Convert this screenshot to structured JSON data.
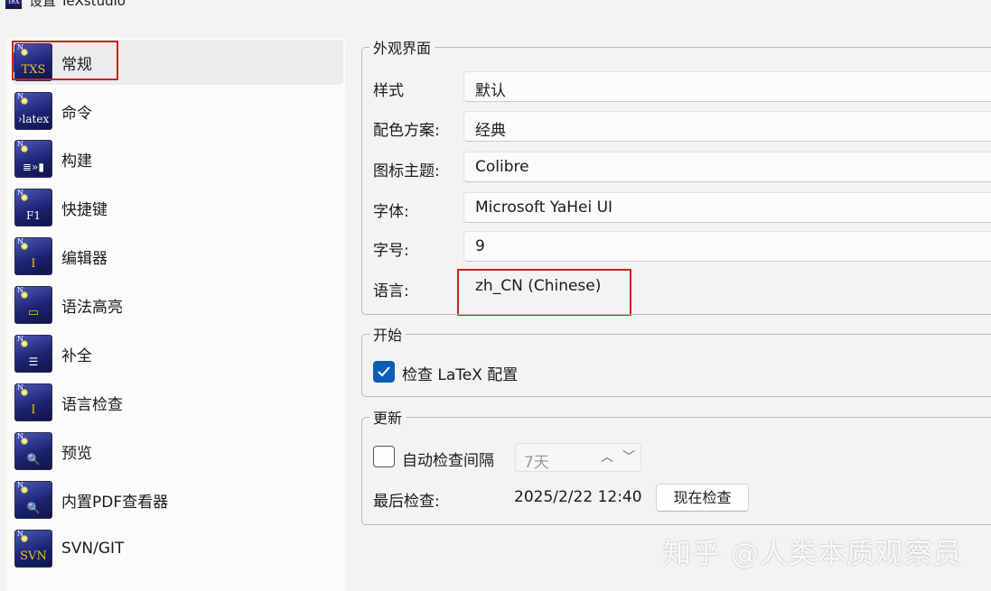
{
  "window": {
    "title": "设置 TeXstudio",
    "icon": "texstudio-app-icon"
  },
  "sidebar": {
    "items": [
      {
        "label": "常规",
        "icon": "txs-icon",
        "glyph": "TXS",
        "selected": true
      },
      {
        "label": "命令",
        "icon": "latex-command-icon",
        "glyph": "›latex"
      },
      {
        "label": "构建",
        "icon": "build-icon",
        "glyph": "≣»▮"
      },
      {
        "label": "快捷键",
        "icon": "keyboard-f1-icon",
        "glyph": "F1"
      },
      {
        "label": "编辑器",
        "icon": "editor-cursor-icon",
        "glyph": "I"
      },
      {
        "label": "语法高亮",
        "icon": "syntax-highlight-icon",
        "glyph": "▭"
      },
      {
        "label": "补全",
        "icon": "completion-list-icon",
        "glyph": "☰"
      },
      {
        "label": "语言检查",
        "icon": "language-check-icon",
        "glyph": "I"
      },
      {
        "label": "预览",
        "icon": "preview-magnifier-icon",
        "glyph": "🔍"
      },
      {
        "label": "内置PDF查看器",
        "icon": "pdf-viewer-icon",
        "glyph": "🔍"
      },
      {
        "label": "SVN/GIT",
        "icon": "svn-git-icon",
        "glyph": "SVN"
      }
    ]
  },
  "appearance": {
    "title": "外观界面",
    "style_label": "样式",
    "style_value": "默认",
    "color_scheme_label": "配色方案:",
    "color_scheme_value": "经典",
    "icon_theme_label": "图标主题:",
    "icon_theme_value": "Colibre",
    "font_label": "字体:",
    "font_value": "Microsoft YaHei UI",
    "font_size_label": "字号:",
    "font_size_value": "9",
    "language_label": "语言:",
    "language_value": "zh_CN  (Chinese)"
  },
  "startup": {
    "title": "开始",
    "check_latex_label": "检查 LaTeX 配置",
    "check_latex_checked": true
  },
  "update": {
    "title": "更新",
    "auto_check_label": "自动检查间隔",
    "auto_check_checked": false,
    "interval_value": "7天",
    "last_check_label": "最后检查:",
    "last_check_value": "2025/2/22 12:40",
    "check_now_label": "现在检查"
  },
  "watermark": "知乎 @人类本质观察员",
  "colors": {
    "highlight_box": "#d02020",
    "accent": "#0067c0",
    "checkbox_checked": "#0a5fb4"
  }
}
